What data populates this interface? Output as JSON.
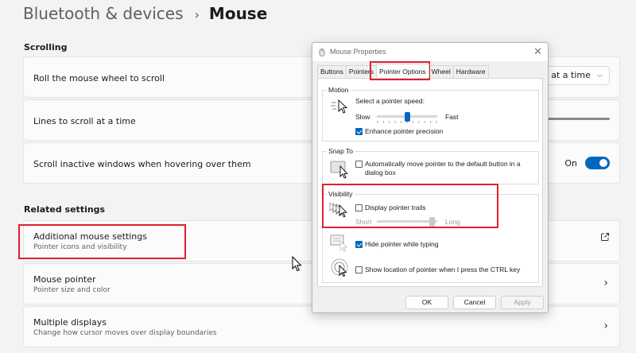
{
  "breadcrumb": {
    "parent": "Bluetooth & devices",
    "separator": "›",
    "current": "Mouse"
  },
  "scrolling": {
    "title": "Scrolling",
    "roll_wheel": {
      "label": "Roll the mouse wheel to scroll",
      "value": "s at a time"
    },
    "lines_to_scroll": {
      "label": "Lines to scroll at a time"
    },
    "scroll_inactive": {
      "label": "Scroll inactive windows when hovering over them",
      "toggle_text": "On",
      "toggle_on": true
    }
  },
  "related": {
    "title": "Related settings",
    "items": [
      {
        "label": "Additional mouse settings",
        "sublabel": "Pointer icons and visibility",
        "icon": "external-link-icon"
      },
      {
        "label": "Mouse pointer",
        "sublabel": "Pointer size and color",
        "icon": "chevron-right-icon"
      },
      {
        "label": "Multiple displays",
        "sublabel": "Change how cursor moves over display boundaries",
        "icon": "chevron-right-icon"
      }
    ]
  },
  "dialog": {
    "title": "Mouse Properties",
    "close": "✕",
    "tabs": [
      "Buttons",
      "Pointers",
      "Pointer Options",
      "Wheel",
      "Hardware"
    ],
    "active_tab": "Pointer Options",
    "motion": {
      "title": "Motion",
      "speed_label": "Select a pointer speed:",
      "slow": "Slow",
      "fast": "Fast",
      "speed_position": 0.5,
      "enhance_label": "Enhance pointer precision",
      "enhance_checked": true
    },
    "snap_to": {
      "title": "Snap To",
      "label": "Automatically move pointer to the default button in a dialog box",
      "checked": false
    },
    "visibility": {
      "title": "Visibility",
      "trails_label": "Display pointer trails",
      "trails_checked": false,
      "short": "Short",
      "long": "Long",
      "trail_position": 0.95,
      "hide_label": "Hide pointer while typing",
      "hide_checked": true,
      "ctrl_label": "Show location of pointer when I press the CTRL key",
      "ctrl_checked": false
    },
    "buttons": {
      "ok": "OK",
      "cancel": "Cancel",
      "apply": "Apply"
    }
  },
  "colors": {
    "accent": "#0067c0",
    "highlight": "#e0202d"
  }
}
